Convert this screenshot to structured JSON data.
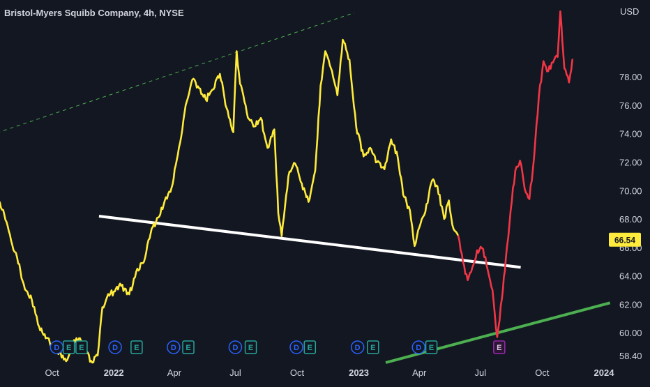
{
  "chart_data": {
    "type": "line",
    "title": "Bristol-Myers Squibb Company, 4h, NYSE",
    "currency": "USD",
    "ylim": [
      57.9,
      83.4
    ],
    "y_ticks": [
      58.4,
      60.0,
      62.0,
      64.0,
      66.0,
      68.0,
      70.0,
      72.0,
      74.0,
      76.0,
      78.0
    ],
    "y_tick_labels": [
      "58.40",
      "60.00",
      "62.00",
      "64.00",
      "66.00",
      "68.00",
      "70.00",
      "72.00",
      "74.00",
      "76.00",
      "78.00"
    ],
    "x_ticks": [
      {
        "label": "Oct",
        "date": "2021-10-01",
        "bold": false
      },
      {
        "label": "2022",
        "date": "2022-01-01",
        "bold": true
      },
      {
        "label": "Apr",
        "date": "2022-04-01",
        "bold": false
      },
      {
        "label": "Jul",
        "date": "2022-07-01",
        "bold": false
      },
      {
        "label": "Oct",
        "date": "2022-10-01",
        "bold": false
      },
      {
        "label": "2023",
        "date": "2023-01-01",
        "bold": true
      },
      {
        "label": "Apr",
        "date": "2023-04-01",
        "bold": false
      },
      {
        "label": "Jul",
        "date": "2023-07-01",
        "bold": false
      },
      {
        "label": "Oct",
        "date": "2023-10-01",
        "bold": false
      },
      {
        "label": "2024",
        "date": "2024-01-01",
        "bold": true
      }
    ],
    "current_price": {
      "value": 66.54,
      "label": "66.54",
      "color": "#ffeb3b"
    },
    "series": [
      {
        "color": "#ffeb3b",
        "points": [
          [
            "2021-07-05",
            69.0
          ],
          [
            "2021-07-12",
            69.4
          ],
          [
            "2021-07-22",
            68.3
          ],
          [
            "2021-08-01",
            66.5
          ],
          [
            "2021-08-10",
            65.3
          ],
          [
            "2021-08-20",
            63.4
          ],
          [
            "2021-09-01",
            62.3
          ],
          [
            "2021-09-10",
            60.6
          ],
          [
            "2021-09-20",
            59.9
          ],
          [
            "2021-10-01",
            59.0
          ],
          [
            "2021-10-12",
            58.6
          ],
          [
            "2021-10-22",
            58.0
          ],
          [
            "2021-11-01",
            59.2
          ],
          [
            "2021-11-10",
            59.6
          ],
          [
            "2021-11-20",
            58.7
          ],
          [
            "2021-11-30",
            57.9
          ],
          [
            "2021-12-08",
            58.4
          ],
          [
            "2021-12-15",
            61.8
          ],
          [
            "2021-12-22",
            62.5
          ],
          [
            "2022-01-01",
            62.9
          ],
          [
            "2022-01-12",
            63.3
          ],
          [
            "2022-01-24",
            62.7
          ],
          [
            "2022-02-05",
            64.5
          ],
          [
            "2022-02-15",
            65.0
          ],
          [
            "2022-02-25",
            67.0
          ],
          [
            "2022-03-08",
            68.1
          ],
          [
            "2022-03-18",
            69.3
          ],
          [
            "2022-03-28",
            70.2
          ],
          [
            "2022-04-08",
            73.0
          ],
          [
            "2022-04-18",
            76.0
          ],
          [
            "2022-04-28",
            77.8
          ],
          [
            "2022-05-08",
            77.2
          ],
          [
            "2022-05-18",
            76.4
          ],
          [
            "2022-05-28",
            77.1
          ],
          [
            "2022-06-08",
            78.2
          ],
          [
            "2022-06-18",
            75.8
          ],
          [
            "2022-06-28",
            74.1
          ],
          [
            "2022-07-03",
            79.8
          ],
          [
            "2022-07-08",
            77.5
          ],
          [
            "2022-07-18",
            75.5
          ],
          [
            "2022-07-28",
            74.5
          ],
          [
            "2022-08-08",
            75.1
          ],
          [
            "2022-08-18",
            73.0
          ],
          [
            "2022-08-28",
            74.3
          ],
          [
            "2022-09-03",
            68.4
          ],
          [
            "2022-09-08",
            66.8
          ],
          [
            "2022-09-18",
            71.0
          ],
          [
            "2022-09-28",
            71.9
          ],
          [
            "2022-10-08",
            70.5
          ],
          [
            "2022-10-18",
            69.2
          ],
          [
            "2022-10-28",
            71.4
          ],
          [
            "2022-11-05",
            77.4
          ],
          [
            "2022-11-12",
            79.8
          ],
          [
            "2022-11-22",
            78.4
          ],
          [
            "2022-11-30",
            76.7
          ],
          [
            "2022-12-08",
            80.6
          ],
          [
            "2022-12-18",
            79.2
          ],
          [
            "2022-12-28",
            74.5
          ],
          [
            "2023-01-08",
            72.4
          ],
          [
            "2023-01-18",
            73.0
          ],
          [
            "2023-01-28",
            72.0
          ],
          [
            "2023-02-08",
            71.5
          ],
          [
            "2023-02-18",
            73.6
          ],
          [
            "2023-02-28",
            72.3
          ],
          [
            "2023-03-08",
            69.7
          ],
          [
            "2023-03-18",
            68.6
          ],
          [
            "2023-03-25",
            66.1
          ],
          [
            "2023-04-01",
            67.4
          ],
          [
            "2023-04-10",
            68.5
          ],
          [
            "2023-04-20",
            70.7
          ],
          [
            "2023-04-28",
            70.3
          ],
          [
            "2023-05-08",
            68.0
          ],
          [
            "2023-05-15",
            69.3
          ],
          [
            "2023-05-22",
            67.3
          ],
          [
            "2023-05-29",
            66.8
          ]
        ]
      },
      {
        "color": "#f23645",
        "points": [
          [
            "2023-05-29",
            66.8
          ],
          [
            "2023-06-05",
            65.0
          ],
          [
            "2023-06-12",
            63.7
          ],
          [
            "2023-06-19",
            64.6
          ],
          [
            "2023-06-26",
            65.8
          ],
          [
            "2023-07-05",
            65.9
          ],
          [
            "2023-07-12",
            64.4
          ],
          [
            "2023-07-19",
            63.0
          ],
          [
            "2023-07-26",
            59.7
          ],
          [
            "2023-08-02",
            62.4
          ],
          [
            "2023-08-08",
            65.3
          ],
          [
            "2023-08-15",
            68.6
          ],
          [
            "2023-08-22",
            71.4
          ],
          [
            "2023-08-29",
            72.1
          ],
          [
            "2023-09-05",
            70.1
          ],
          [
            "2023-09-12",
            69.4
          ],
          [
            "2023-09-19",
            72.4
          ],
          [
            "2023-09-26",
            76.6
          ],
          [
            "2023-10-03",
            79.1
          ],
          [
            "2023-10-10",
            78.4
          ],
          [
            "2023-10-17",
            79.0
          ],
          [
            "2023-10-24",
            79.4
          ],
          [
            "2023-10-28",
            82.6
          ],
          [
            "2023-11-03",
            78.6
          ],
          [
            "2023-11-10",
            77.6
          ],
          [
            "2023-11-15",
            79.2
          ]
        ]
      }
    ],
    "trendlines": [
      {
        "color": "#ffffff",
        "style": "solid",
        "from": [
          "2021-12-10",
          68.2
        ],
        "to": [
          "2023-08-30",
          64.6
        ]
      },
      {
        "color": "#4caf50",
        "style": "solid",
        "from": [
          "2023-02-10",
          57.9
        ],
        "to": [
          "2024-01-10",
          62.1
        ]
      },
      {
        "color": "#4caf50",
        "style": "dashed",
        "from": [
          "2021-07-01",
          73.9
        ],
        "to": [
          "2022-12-25",
          82.5
        ]
      }
    ],
    "event_markers": [
      {
        "label": "D",
        "date": "2021-10-08",
        "color": "#2962ff"
      },
      {
        "label": "E",
        "date": "2021-10-26",
        "color": "#26a69a"
      },
      {
        "label": "E",
        "date": "2021-11-14",
        "color": "#26a69a"
      },
      {
        "label": "D",
        "date": "2022-01-03",
        "color": "#2962ff"
      },
      {
        "label": "E",
        "date": "2022-02-04",
        "color": "#26a69a"
      },
      {
        "label": "D",
        "date": "2022-03-31",
        "color": "#2962ff"
      },
      {
        "label": "E",
        "date": "2022-04-22",
        "color": "#26a69a"
      },
      {
        "label": "D",
        "date": "2022-07-01",
        "color": "#2962ff"
      },
      {
        "label": "E",
        "date": "2022-07-24",
        "color": "#26a69a"
      },
      {
        "label": "D",
        "date": "2022-09-30",
        "color": "#2962ff"
      },
      {
        "label": "E",
        "date": "2022-10-20",
        "color": "#26a69a"
      },
      {
        "label": "D",
        "date": "2022-12-30",
        "color": "#2962ff"
      },
      {
        "label": "E",
        "date": "2023-01-22",
        "color": "#26a69a"
      },
      {
        "label": "D",
        "date": "2023-03-31",
        "color": "#2962ff"
      },
      {
        "label": "E",
        "date": "2023-04-19",
        "color": "#26a69a"
      },
      {
        "label": "E",
        "date": "2023-07-29",
        "color": "#9c27b0"
      }
    ]
  }
}
